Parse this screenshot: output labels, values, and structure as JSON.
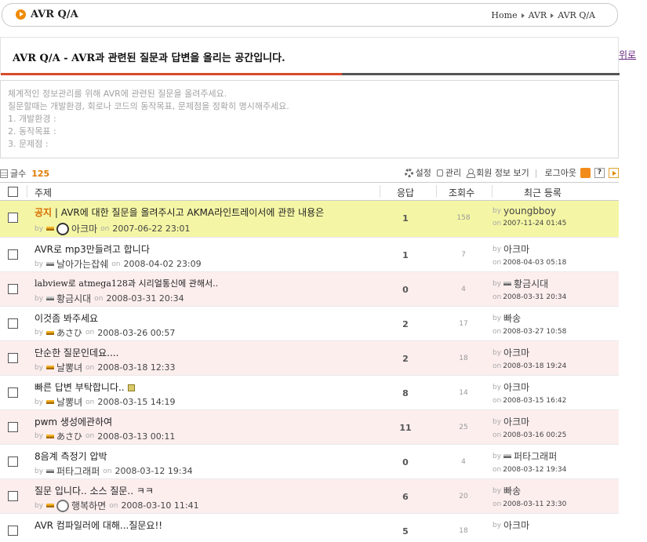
{
  "header": {
    "title": "AVR Q/A",
    "breadcrumb": [
      "Home",
      "AVR",
      "AVR Q/A"
    ]
  },
  "banner": {
    "text": "AVR Q/A - AVR과 관련된 질문과 답변을 올리는 공간입니다.",
    "back_link": "위로"
  },
  "notice": {
    "lines": [
      "체계적인 정보관리를 위해 AVR에 관련된 질문을 올려주세요.",
      "질문할때는 개발환경, 회로나 코드의 동작목표, 문제점을 정확히 명시해주세요.",
      "1. 개발환경 :",
      "2. 동작목표 :",
      "3. 문제점 :"
    ]
  },
  "toolbar": {
    "count_label": "글수",
    "count_value": "125",
    "settings": "설정",
    "admin": "관리",
    "member_info": "회원 정보 보기",
    "logout": "로그아웃"
  },
  "table": {
    "columns": {
      "subject": "주제",
      "replies": "응답",
      "views": "조회수",
      "last": "최근 등록"
    },
    "rows": [
      {
        "tag": "공지",
        "subject": " | AVR에 대한 질문을 올려주시고 AKMA라인트레이서에 관한 내용은",
        "author": "아크마",
        "date": "2007-06-22 23:01",
        "replies": "1",
        "views": "158",
        "last_user": "youngbboy",
        "last_date": "2007-11-24 01:45"
      },
      {
        "tag": "",
        "subject": "AVR로 mp3만들려고 합니다",
        "author": "날아가는잡쉐",
        "date": "2008-04-02 23:09",
        "replies": "1",
        "views": "7",
        "last_user": "아크마",
        "last_date": "2008-04-03 05:18"
      },
      {
        "tag": "",
        "subject": "labview로 atmega128과 시리얼통신에 관해서..",
        "author": "황금시대",
        "date": "2008-03-31 20:34",
        "replies": "0",
        "views": "4",
        "last_user": "황금시대",
        "last_date": "2008-03-31 20:34"
      },
      {
        "tag": "",
        "subject": "이것좀 봐주세요",
        "author": "あさひ",
        "date": "2008-03-26 00:57",
        "replies": "2",
        "views": "17",
        "last_user": "빠송",
        "last_date": "2008-03-27 10:58"
      },
      {
        "tag": "",
        "subject": "단순한 질문인데요....",
        "author": "날뽕녀",
        "date": "2008-03-18 12:33",
        "replies": "2",
        "views": "18",
        "last_user": "아크마",
        "last_date": "2008-03-18 19:24"
      },
      {
        "tag": "",
        "subject": "빠른 답변 부탁합니다..",
        "author": "날뽕녀",
        "date": "2008-03-15 14:19",
        "replies": "8",
        "views": "14",
        "last_user": "아크마",
        "last_date": "2008-03-15 16:42"
      },
      {
        "tag": "",
        "subject": "pwm 생성에관하여",
        "author": "あさひ",
        "date": "2008-03-13 00:11",
        "replies": "11",
        "views": "25",
        "last_user": "아크마",
        "last_date": "2008-03-16 00:25"
      },
      {
        "tag": "",
        "subject": "8음계 측정기 압박",
        "author": "퍼타그래퍼",
        "date": "2008-03-12 19:34",
        "replies": "0",
        "views": "4",
        "last_user": "퍼타그래퍼",
        "last_date": "2008-03-12 19:34"
      },
      {
        "tag": "",
        "subject": "질문 입니다.. 소스 질문.. ㅋㅋ",
        "author": "행복하면",
        "date": "2008-03-10 11:41",
        "replies": "6",
        "views": "20",
        "last_user": "빠송",
        "last_date": "2008-03-11 23:30"
      },
      {
        "tag": "",
        "subject": "AVR 컴파일러에 대해...질문요!!",
        "author": "",
        "date": "",
        "replies": "5",
        "views": "18",
        "last_user": "아크마",
        "last_date": ""
      }
    ],
    "by": "by",
    "on": "on"
  }
}
